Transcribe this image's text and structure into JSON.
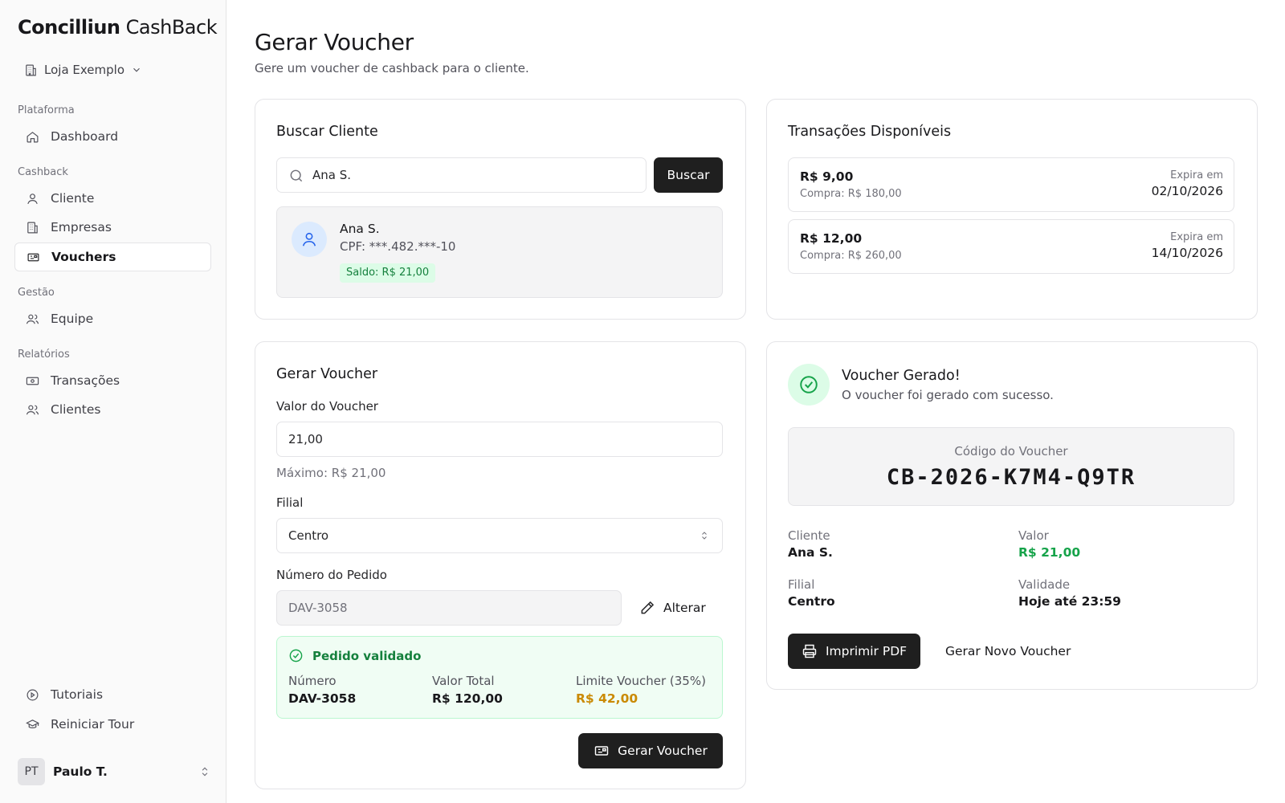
{
  "brand": {
    "bold": "Concilliun",
    "light": "CashBack"
  },
  "store": {
    "name": "Loja Exemplo"
  },
  "sidebar": {
    "sections": {
      "plataforma": "Plataforma",
      "cashback": "Cashback",
      "gestao": "Gestão",
      "relatorios": "Relatórios"
    },
    "items": {
      "dashboard": "Dashboard",
      "cliente": "Cliente",
      "empresas": "Empresas",
      "vouchers": "Vouchers",
      "equipe": "Equipe",
      "transacoes": "Transações",
      "clientes": "Clientes",
      "tutoriais": "Tutoriais",
      "reiniciar_tour": "Reiniciar Tour"
    },
    "active": "Vouchers",
    "user": {
      "initials": "PT",
      "name": "Paulo T."
    }
  },
  "page": {
    "title": "Gerar Voucher",
    "subtitle": "Gere um voucher de cashback para o cliente."
  },
  "search_card": {
    "title": "Buscar Cliente",
    "query": "Ana S.",
    "button": "Buscar",
    "result": {
      "name": "Ana S.",
      "cpf": "CPF: ***.482.***-10",
      "balance": "Saldo: R$ 21,00"
    }
  },
  "transactions_card": {
    "title": "Transações Disponíveis",
    "items": [
      {
        "amount": "R$ 9,00",
        "purchase": "Compra: R$ 180,00",
        "expires_label": "Expira em",
        "expires": "02/10/2026"
      },
      {
        "amount": "R$ 12,00",
        "purchase": "Compra: R$ 260,00",
        "expires_label": "Expira em",
        "expires": "14/10/2026"
      }
    ]
  },
  "form_card": {
    "title": "Gerar Voucher",
    "value_label": "Valor do Voucher",
    "value": "21,00",
    "max_hint": "Máximo: R$ 21,00",
    "branch_label": "Filial",
    "branch": "Centro",
    "order_label": "Número do Pedido",
    "order_value": "DAV-3058",
    "change_button": "Alterar",
    "validation": {
      "title": "Pedido validado",
      "number_label": "Número",
      "number": "DAV-3058",
      "total_label": "Valor Total",
      "total": "R$ 120,00",
      "limit_label": "Limite Voucher (35%)",
      "limit": "R$ 42,00"
    },
    "submit": "Gerar Voucher"
  },
  "result_card": {
    "title": "Voucher Gerado!",
    "subtitle": "O voucher foi gerado com sucesso.",
    "code_label": "Código do Voucher",
    "code": "CB-2026-K7M4-Q9TR",
    "client_label": "Cliente",
    "client": "Ana S.",
    "value_label": "Valor",
    "value": "R$ 21,00",
    "branch_label": "Filial",
    "branch": "Centro",
    "validity_label": "Validade",
    "validity": "Hoje até 23:59",
    "print_button": "Imprimir PDF",
    "new_button": "Gerar Novo Voucher"
  },
  "colors": {
    "success": "#16a34a",
    "warning": "#ca8a04",
    "dark": "#1f1f1f",
    "accent_blue": "#2563eb"
  }
}
